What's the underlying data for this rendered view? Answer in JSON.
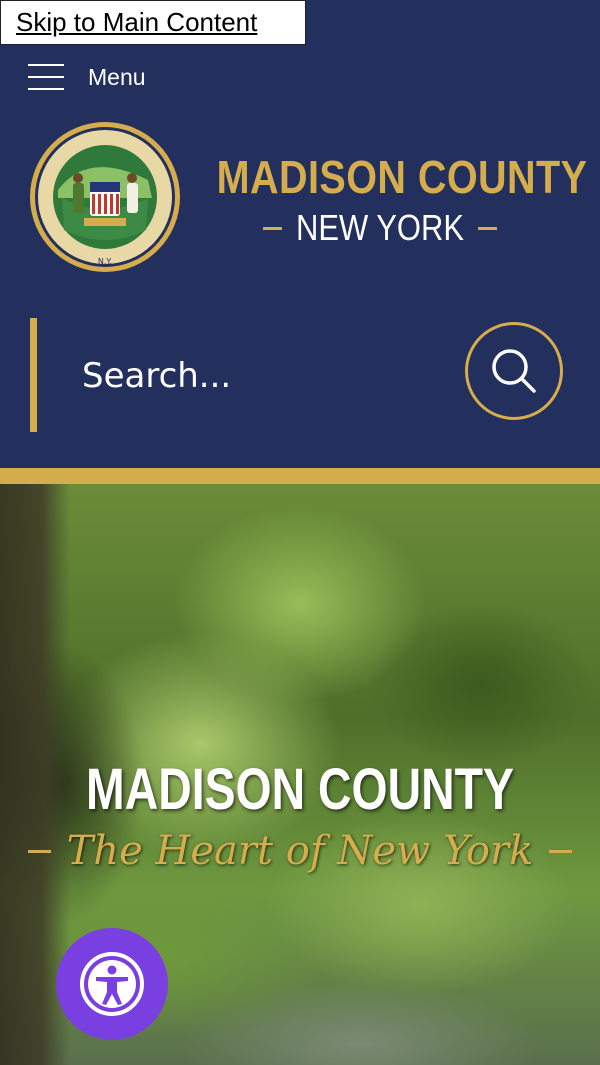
{
  "skip_link": {
    "label": "Skip to Main Content"
  },
  "header": {
    "menu_label": "Menu",
    "logo": {
      "seal_text_top": "MADISON COUNTY",
      "seal_text_bottom": "N.Y.",
      "title": "MADISON COUNTY",
      "subtitle": "NEW YORK"
    },
    "search": {
      "placeholder": "Search..."
    }
  },
  "hero": {
    "title": "MADISON COUNTY",
    "tagline": "The Heart of New York"
  },
  "colors": {
    "navy": "#232f5c",
    "gold": "#d6ad4c",
    "accessibility_purple": "#7a3fe0"
  },
  "icons": {
    "menu": "hamburger-icon",
    "search": "search-icon",
    "accessibility": "accessibility-icon"
  }
}
